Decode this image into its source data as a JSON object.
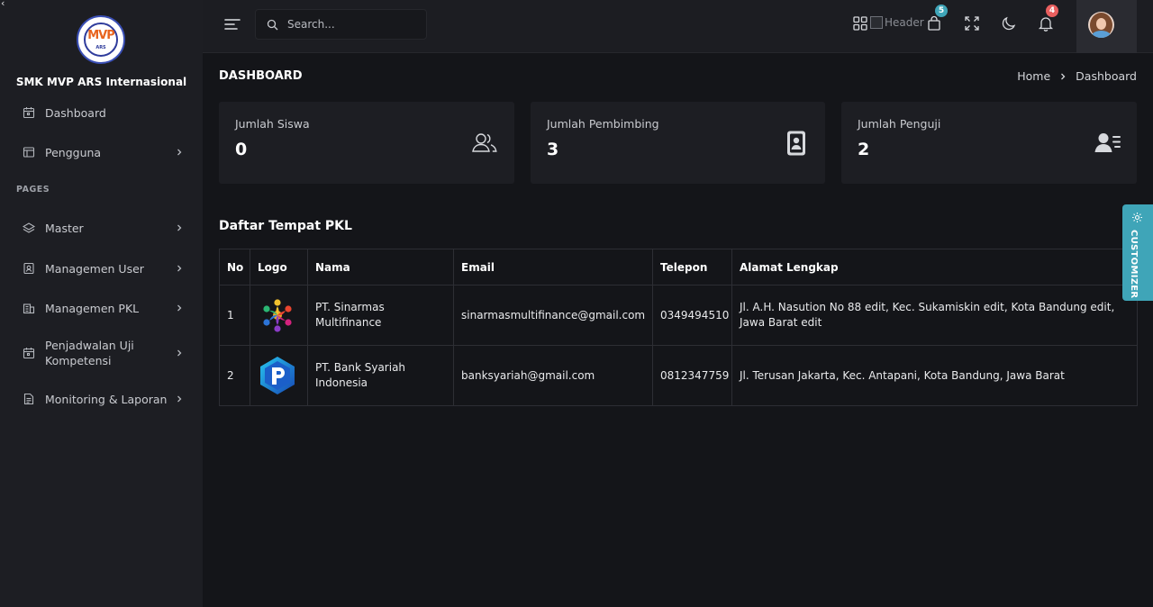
{
  "sidebar": {
    "brand": "SMK MVP ARS Internasional",
    "logo": {
      "mark": "MVP",
      "sub": "ARS"
    },
    "top_items": [
      {
        "label": "Dashboard",
        "icon": "calendar-icon"
      },
      {
        "label": "Pengguna",
        "icon": "table-icon"
      }
    ],
    "section": "PAGES",
    "items": [
      {
        "label": "Master",
        "icon": "layers-icon"
      },
      {
        "label": "Managemen User",
        "icon": "user-card-icon"
      },
      {
        "label": "Managemen PKL",
        "icon": "building-icon"
      },
      {
        "label": "Penjadwalan Uji Kompetensi",
        "icon": "calendar-icon"
      },
      {
        "label": "Monitoring & Laporan",
        "icon": "report-icon"
      }
    ]
  },
  "topbar": {
    "search_placeholder": "Search...",
    "header_img_alt": "Header",
    "cart_badge": "5",
    "notif_badge": "4",
    "colors": {
      "cart_badge": "#3fa5b8",
      "notif_badge": "#e95f5f"
    }
  },
  "page": {
    "title": "DASHBOARD",
    "breadcrumb": [
      "Home",
      "Dashboard"
    ]
  },
  "cards": [
    {
      "label": "Jumlah Siswa",
      "value": "0",
      "icon": "users-icon"
    },
    {
      "label": "Jumlah Pembimbing",
      "value": "3",
      "icon": "id-badge-icon"
    },
    {
      "label": "Jumlah Penguji",
      "value": "2",
      "icon": "user-list-icon"
    }
  ],
  "table": {
    "title": "Daftar Tempat PKL",
    "headers": [
      "No",
      "Logo",
      "Nama",
      "Email",
      "Telepon",
      "Alamat Lengkap"
    ],
    "rows": [
      {
        "no": "1",
        "nama": "PT. Sinarmas Multifinance",
        "email": "sinarmasmultifinance@gmail.com",
        "telepon": "0349494510",
        "alamat": "Jl. A.H. Nasution No 88 edit, Kec. Sukamiskin edit, Kota Bandung edit, Jawa Barat edit",
        "logo": "people-circle-logo"
      },
      {
        "no": "2",
        "nama": "PT. Bank Syariah Indonesia",
        "email": "banksyariah@gmail.com",
        "telepon": "0812347759",
        "alamat": "Jl. Terusan Jakarta, Kec. Antapani, Kota Bandung, Jawa Barat",
        "logo": "p-cube-logo"
      }
    ]
  },
  "customizer_label": "CUSTOMIZER",
  "accent": "#3fa5b8"
}
